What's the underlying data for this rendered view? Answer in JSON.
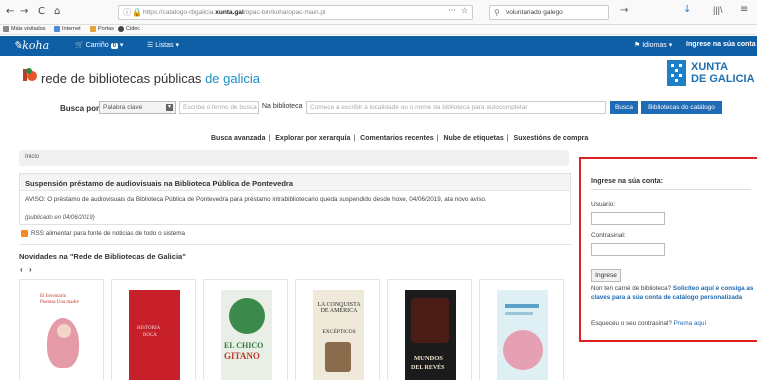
{
  "browser": {
    "back": "←",
    "forward": "→",
    "reload": "C",
    "home": "⌂",
    "url_prefix": "https://catalogo-rbgalicia.",
    "url_domain": "xunta.gal",
    "url_suffix": "/opac-bin/koha/opac-main.pl",
    "url_menu": "···",
    "pocket": "♥",
    "star": "☆",
    "search_text": "voluntariado galego",
    "go": "→",
    "download": "↓",
    "library": "|||\\",
    "extra": "⚡",
    "menu": "≡"
  },
  "bookmarks": [
    {
      "label": "Máis visitados"
    },
    {
      "label": "Internet"
    },
    {
      "label": "Portas"
    },
    {
      "label": "Cidec"
    }
  ],
  "koha_nav": {
    "logo": "koha",
    "cart_label": "Carriño",
    "cart_count": "0",
    "lists_label": "Listas",
    "languages": "Idiomas",
    "login": "Ingrese na súa conta"
  },
  "header": {
    "logo_main": "rede de bibliotecas públicas ",
    "logo_accent": "de galicia",
    "xunta_line1": "XUNTA",
    "xunta_line2": "DE GALICIA"
  },
  "search": {
    "label": "Busca por",
    "select_value": "Palabra clave",
    "input_placeholder": "Escriba o termo de busca",
    "library_label": "Na biblioteca",
    "library_placeholder": "Comece a escribir a localidade ou o nome da biblioteca para autocompletar",
    "button": "Busca",
    "catalog_button": "Bibliotecas do catálogo"
  },
  "moresearches": [
    "Busca avanzada",
    "Explorar por xerarquía",
    "Comentarios recentes",
    "Nube de etiquetas",
    "Suxestións de compra"
  ],
  "breadcrumb": "Inicio",
  "news": {
    "title": "Suspensión préstamo de audiovisuais na Biblioteca Pública de Pontevedra",
    "body": "AVISO: O préstamo de audiovisuais da Biblioteca Pública de Pontevedra para préstamo intrabibliotecario queda suspendido desde hoxe, 04/06/2019, ata novo aviso.",
    "date": "(publicado en 04/06/2019)"
  },
  "rss": "RSS alimentar para fonte de noticias de todo o sistema",
  "novidades": {
    "title": "Novidades na \"Rede de Bibliotecas de Galicia\"",
    "prev": "‹",
    "next": "›",
    "books": [
      {
        "line1": "El Inventario",
        "line2": "Poemas Una madre",
        "bg": "#ffffff",
        "fg": "#c0392b"
      },
      {
        "line1": "HISTORIA",
        "line2": "ROCA",
        "bg": "#c8202a",
        "fg": "#f4d6d6"
      },
      {
        "line1": "EL CHICO",
        "line2": "GITANO",
        "bg": "#e9efe6",
        "fg": "#2f7a3f"
      },
      {
        "line1": "LA CONQUISTA DE AMÉRICA",
        "line2": "EXCÉPTICOS",
        "bg": "#efe9da",
        "fg": "#2c2c2c"
      },
      {
        "line1": "MUNDOS",
        "line2": "DEL REVÉS",
        "bg": "#1b1b1b",
        "fg": "#f1e6d0"
      },
      {
        "line1": "",
        "line2": "",
        "bg": "#dff0f4",
        "fg": "#3a7bb0"
      }
    ]
  },
  "login_panel": {
    "title": "Ingrese na súa conta:",
    "user_label": "Usuario:",
    "pass_label": "Contrasinal:",
    "button": "Ingrese",
    "no_card_text": "Non ten carné de biblioteca? ",
    "no_card_link": "Solicíteo aquí e consiga as claves para a súa conta de catálogo personalizada",
    "forgot_text": "Esqueceu o seu contrasinal? ",
    "forgot_link": "Prema aquí"
  },
  "colors": {
    "navbar": "#0f5fa6",
    "accent": "#1b8ec9",
    "button": "#1f6bb5",
    "highlight_border": "#e02020"
  }
}
